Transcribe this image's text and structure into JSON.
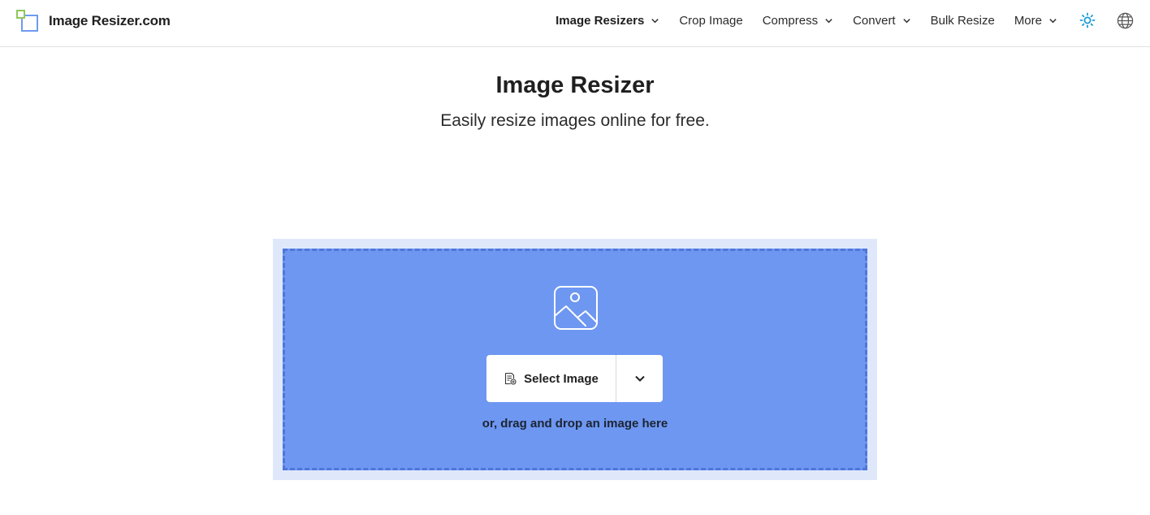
{
  "brand": {
    "name": "Image Resizer.com"
  },
  "nav": {
    "items": [
      {
        "label": "Image Resizers",
        "has_dropdown": true,
        "active": true
      },
      {
        "label": "Crop Image",
        "has_dropdown": false
      },
      {
        "label": "Compress",
        "has_dropdown": true
      },
      {
        "label": "Convert",
        "has_dropdown": true
      },
      {
        "label": "Bulk Resize",
        "has_dropdown": false
      },
      {
        "label": "More",
        "has_dropdown": true
      }
    ],
    "icons": [
      "sun-icon",
      "globe-icon"
    ]
  },
  "hero": {
    "title": "Image Resizer",
    "subtitle": "Easily resize images online for free."
  },
  "upload": {
    "select_label": "Select Image",
    "drag_text": "or, drag and drop an image here"
  },
  "colors": {
    "accent": "#6e97f1",
    "drop_outer": "#dfe8fb",
    "logo_green": "#8fc85a",
    "logo_blue": "#6f9bf0",
    "sun_icon": "#1a9ad6"
  }
}
